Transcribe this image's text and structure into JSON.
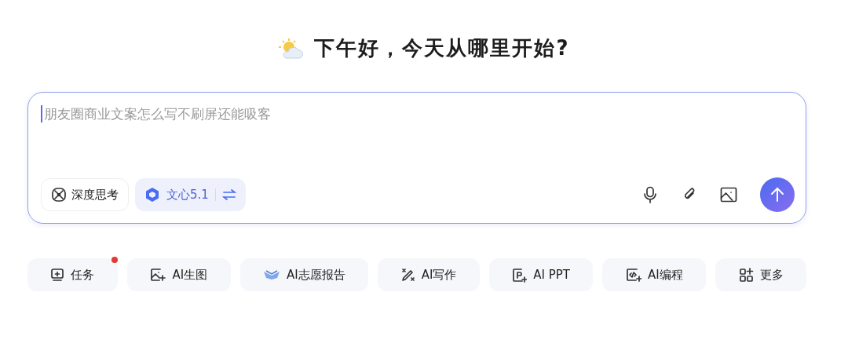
{
  "greeting": "下午好，今天从哪里开始?",
  "input": {
    "placeholder": "朋友圈商业文案怎么写不刷屏还能吸客"
  },
  "deep_think": {
    "label": "深度思考",
    "selected": false
  },
  "model": {
    "label": "文心5.1"
  },
  "shortcuts": [
    {
      "kind": "task",
      "label": "任务",
      "badge": true
    },
    {
      "kind": "image",
      "label": "AI生图",
      "badge": false
    },
    {
      "kind": "wish",
      "label": "AI志愿报告",
      "badge": false
    },
    {
      "kind": "write",
      "label": "AI写作",
      "badge": false
    },
    {
      "kind": "ppt",
      "label": "AI PPT",
      "badge": false
    },
    {
      "kind": "code",
      "label": "AI编程",
      "badge": false
    },
    {
      "kind": "more",
      "label": "更多",
      "badge": false
    }
  ]
}
